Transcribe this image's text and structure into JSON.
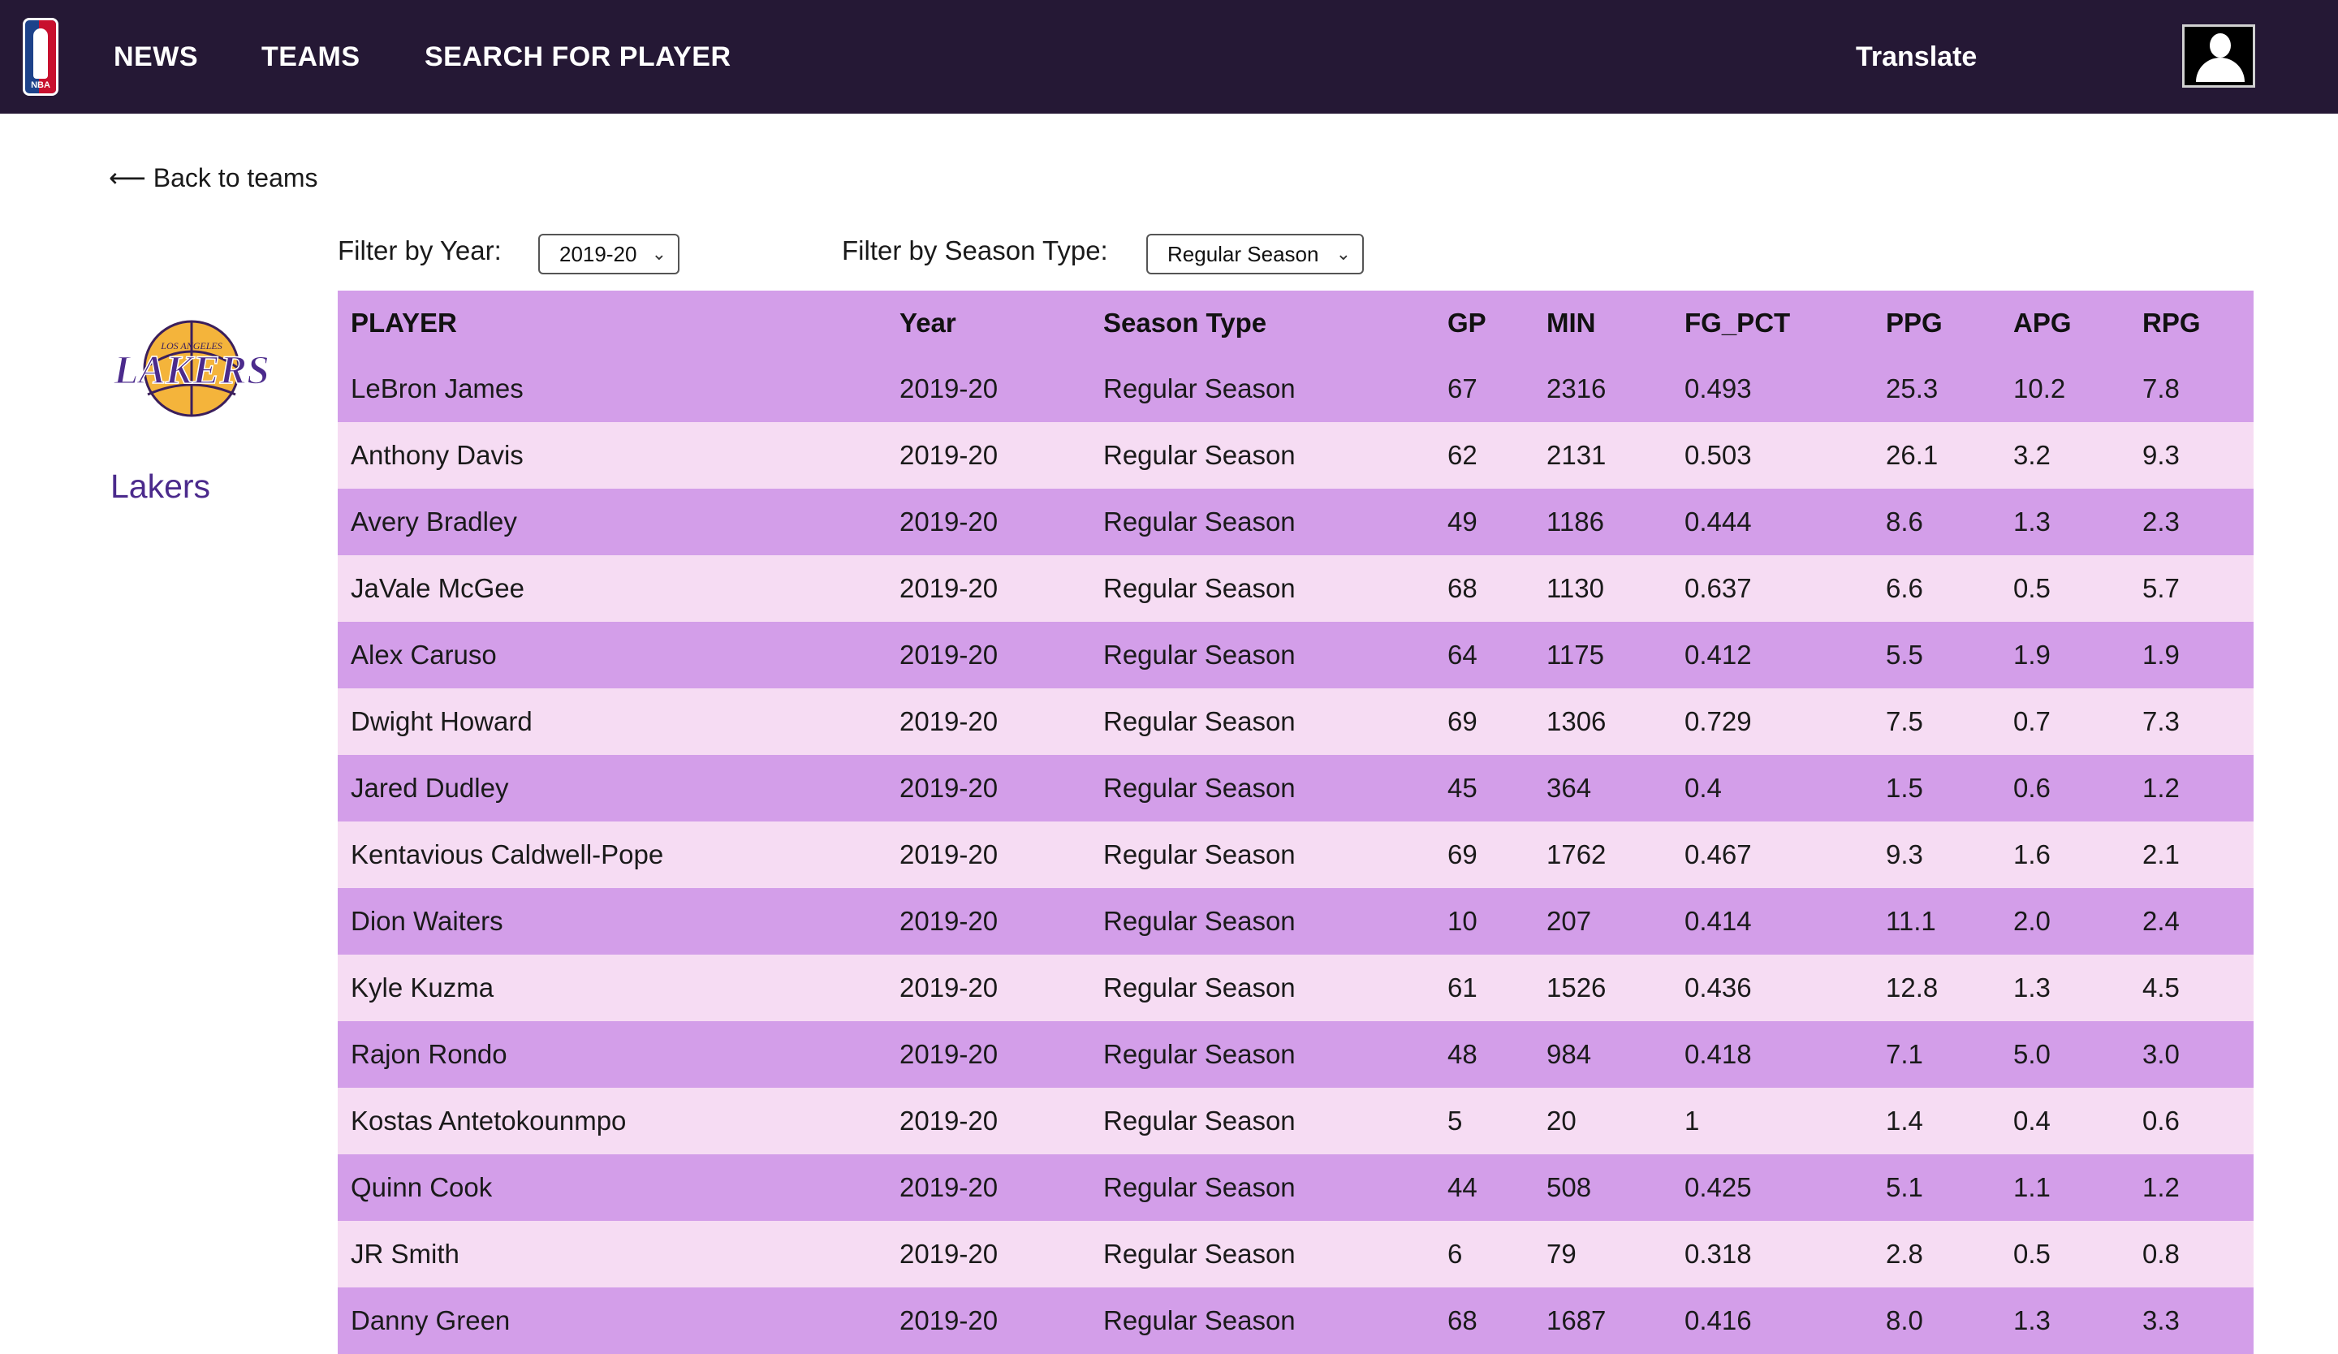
{
  "nav": {
    "logo_text": "NBA",
    "links": [
      "NEWS",
      "TEAMS",
      "SEARCH FOR PLAYER"
    ],
    "translate": "Translate"
  },
  "back_link": "⟵ Back to teams",
  "filters": {
    "year_label": "Filter by Year:",
    "year_value": "2019-20",
    "season_label": "Filter by Season Type:",
    "season_value": "Regular Season"
  },
  "team": {
    "name": "Lakers",
    "logo_top_text": "LOS ANGELES",
    "logo_text": "LAKERS"
  },
  "colors": {
    "topbar": "#251835",
    "row_dark": "#d39ee9",
    "row_light": "#f6dcf3",
    "team_name": "#4b2a8c"
  },
  "table": {
    "columns": [
      "PLAYER",
      "Year",
      "Season Type",
      "GP",
      "MIN",
      "FG_PCT",
      "PPG",
      "APG",
      "RPG"
    ],
    "rows": [
      [
        "LeBron James",
        "2019-20",
        "Regular Season",
        "67",
        "2316",
        "0.493",
        "25.3",
        "10.2",
        "7.8"
      ],
      [
        "Anthony Davis",
        "2019-20",
        "Regular Season",
        "62",
        "2131",
        "0.503",
        "26.1",
        "3.2",
        "9.3"
      ],
      [
        "Avery Bradley",
        "2019-20",
        "Regular Season",
        "49",
        "1186",
        "0.444",
        "8.6",
        "1.3",
        "2.3"
      ],
      [
        "JaVale McGee",
        "2019-20",
        "Regular Season",
        "68",
        "1130",
        "0.637",
        "6.6",
        "0.5",
        "5.7"
      ],
      [
        "Alex Caruso",
        "2019-20",
        "Regular Season",
        "64",
        "1175",
        "0.412",
        "5.5",
        "1.9",
        "1.9"
      ],
      [
        "Dwight Howard",
        "2019-20",
        "Regular Season",
        "69",
        "1306",
        "0.729",
        "7.5",
        "0.7",
        "7.3"
      ],
      [
        "Jared Dudley",
        "2019-20",
        "Regular Season",
        "45",
        "364",
        "0.4",
        "1.5",
        "0.6",
        "1.2"
      ],
      [
        "Kentavious Caldwell-Pope",
        "2019-20",
        "Regular Season",
        "69",
        "1762",
        "0.467",
        "9.3",
        "1.6",
        "2.1"
      ],
      [
        "Dion Waiters",
        "2019-20",
        "Regular Season",
        "10",
        "207",
        "0.414",
        "11.1",
        "2.0",
        "2.4"
      ],
      [
        "Kyle Kuzma",
        "2019-20",
        "Regular Season",
        "61",
        "1526",
        "0.436",
        "12.8",
        "1.3",
        "4.5"
      ],
      [
        "Rajon Rondo",
        "2019-20",
        "Regular Season",
        "48",
        "984",
        "0.418",
        "7.1",
        "5.0",
        "3.0"
      ],
      [
        "Kostas Antetokounmpo",
        "2019-20",
        "Regular Season",
        "5",
        "20",
        "1",
        "1.4",
        "0.4",
        "0.6"
      ],
      [
        "Quinn Cook",
        "2019-20",
        "Regular Season",
        "44",
        "508",
        "0.425",
        "5.1",
        "1.1",
        "1.2"
      ],
      [
        "JR Smith",
        "2019-20",
        "Regular Season",
        "6",
        "79",
        "0.318",
        "2.8",
        "0.5",
        "0.8"
      ],
      [
        "Danny Green",
        "2019-20",
        "Regular Season",
        "68",
        "1687",
        "0.416",
        "8.0",
        "1.3",
        "3.3"
      ]
    ]
  }
}
